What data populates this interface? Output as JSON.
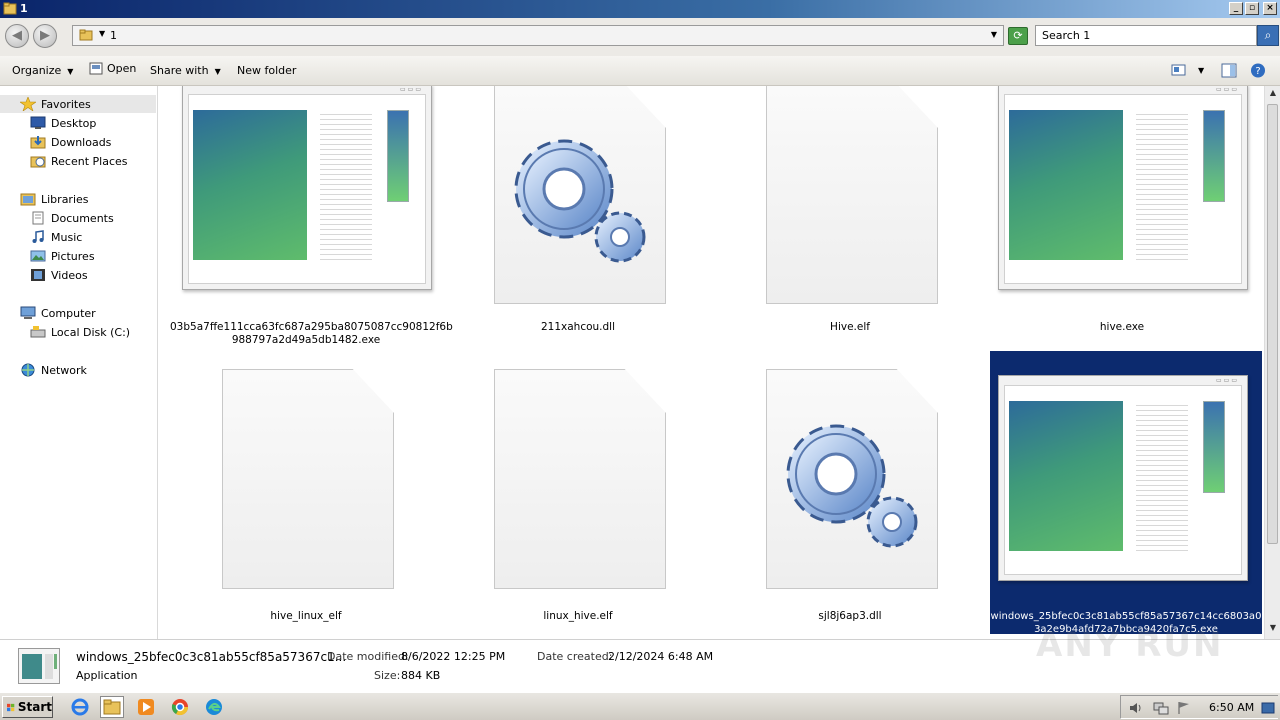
{
  "window": {
    "title": "1",
    "controls": [
      "_",
      "▫",
      "×"
    ]
  },
  "address": {
    "crumb": "1",
    "search_placeholder": "Search 1"
  },
  "toolbar": {
    "organize": "Organize",
    "open": "Open",
    "share_with": "Share with",
    "new_folder": "New folder"
  },
  "nav": {
    "favorites": "Favorites",
    "desktop": "Desktop",
    "downloads": "Downloads",
    "recent_places": "Recent Places",
    "libraries": "Libraries",
    "documents": "Documents",
    "music": "Music",
    "pictures": "Pictures",
    "videos": "Videos",
    "computer": "Computer",
    "local_disk": "Local Disk (C:)",
    "network": "Network"
  },
  "files": [
    {
      "name_line1": "03b5a7ffe111cca63fc687a295ba8075087cc90812f6b",
      "name_line2": "988797a2d49a5db1482.exe",
      "icon": "application-window-icon"
    },
    {
      "name_line1": "211xahcou.dll",
      "name_line2": "",
      "icon": "gears-icon"
    },
    {
      "name_line1": "Hive.elf",
      "name_line2": "",
      "icon": "blank-document-icon"
    },
    {
      "name_line1": "hive.exe",
      "name_line2": "",
      "icon": "application-window-icon"
    },
    {
      "name_line1": "hive_linux_elf",
      "name_line2": "",
      "icon": "blank-document-icon"
    },
    {
      "name_line1": "linux_hive.elf",
      "name_line2": "",
      "icon": "blank-document-icon"
    },
    {
      "name_line1": "sjl8j6ap3.dll",
      "name_line2": "",
      "icon": "gears-icon"
    },
    {
      "name_line1": "windows_25bfec0c3c81ab55cf85a57367c14cc6803a0",
      "name_line2": "3a2e9b4afd72a7bbca9420fa7c5.exe",
      "icon": "application-window-icon",
      "selected": true
    }
  ],
  "details": {
    "name": "windows_25bfec0c3c81ab55cf85a57367c1...",
    "type": "Application",
    "modified_label": "Date modified:",
    "modified_value": "8/6/2022 12:25 PM",
    "size_label": "Size:",
    "size_value": "884 KB",
    "created_label": "Date created:",
    "created_value": "2/12/2024 6:48 AM"
  },
  "taskbar": {
    "start": "Start",
    "clock": "6:50 AM"
  },
  "watermark": "ANY RUN",
  "colors": {
    "selection": "#0c2a6e",
    "titlebar": "#0a246a"
  }
}
